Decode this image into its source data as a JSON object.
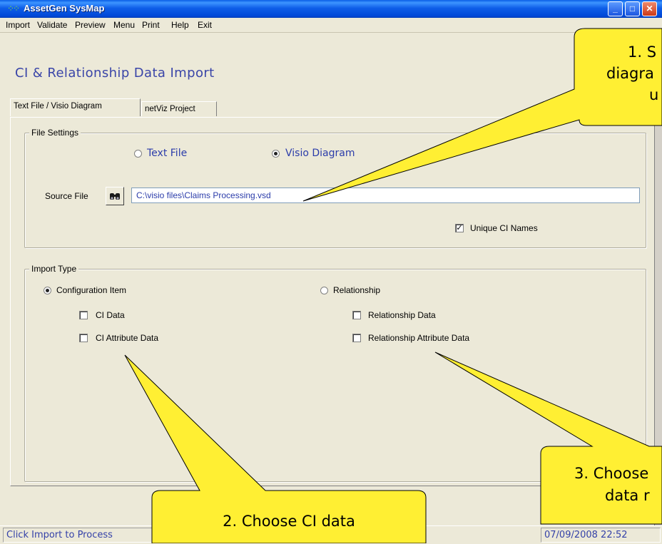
{
  "window": {
    "title": "AssetGen SysMap",
    "minimize_glyph": "_",
    "maximize_glyph": "□",
    "close_glyph": "✕"
  },
  "menu": [
    {
      "label": "Import"
    },
    {
      "label": "Validate"
    },
    {
      "label": "Preview"
    },
    {
      "label": "Menu"
    },
    {
      "label": "Print"
    },
    {
      "label": "Help"
    },
    {
      "label": "Exit"
    }
  ],
  "form": {
    "title": "CI & Relationship Data Import",
    "tabs": [
      {
        "label": "Text File / Visio Diagram",
        "active": true
      },
      {
        "label": "netViz Project",
        "active": false
      }
    ]
  },
  "file_settings": {
    "group_label": "File Settings",
    "option_text_file": "Text File",
    "option_visio": "Visio Diagram",
    "selected": "Visio Diagram",
    "source_label": "Source File",
    "source_value": "C:\\visio files\\Claims Processing.vsd",
    "browse_icon": "binoculars-icon",
    "unique_names_label": "Unique CI Names",
    "unique_names_checked": true
  },
  "import_type": {
    "group_label": "Import Type",
    "option_ci": "Configuration Item",
    "option_rel": "Relationship",
    "selected": "Configuration Item",
    "ci_data_label": "CI Data",
    "ci_attr_label": "CI Attribute Data",
    "rel_data_label": "Relationship Data",
    "rel_attr_label": "Relationship Attribute Data"
  },
  "status": {
    "message": "Click Import to Process",
    "datetime": "07/09/2008  22:52"
  },
  "callouts": {
    "c1_line1": "1. S",
    "c1_line2": "diagra",
    "c1_line3": "u",
    "c2": "2. Choose CI data",
    "c3_line1": "3. Choose",
    "c3_line2": "data r"
  },
  "colors": {
    "callout_fill": "#ffef33",
    "title_blue": "#0a5fe6",
    "form_title": "#3a45a8"
  }
}
